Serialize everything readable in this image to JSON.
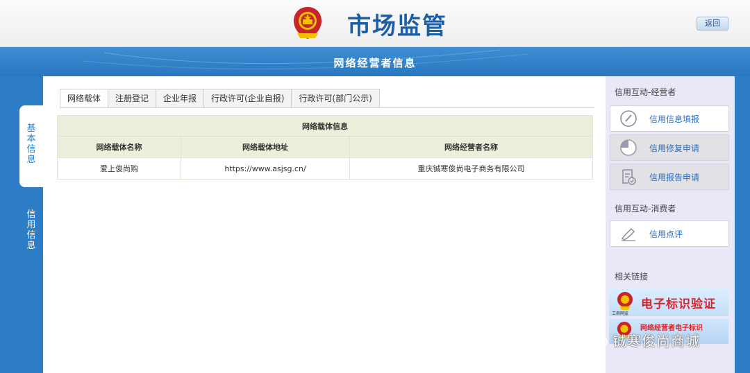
{
  "header": {
    "title": "市场监管",
    "back_label": "返回"
  },
  "section": {
    "title": "网络经营者信息"
  },
  "left_tabs": {
    "basic": "基本信息",
    "credit": "信用信息"
  },
  "tabs": [
    {
      "label": "网络载体"
    },
    {
      "label": "注册登记"
    },
    {
      "label": "企业年报"
    },
    {
      "label": "行政许可(企业自报)"
    },
    {
      "label": "行政许可(部门公示)"
    }
  ],
  "table": {
    "caption": "网络载体信息",
    "columns": [
      "网络载体名称",
      "网络载体地址",
      "网络经营者名称"
    ],
    "rows": [
      [
        "爱上俊尚购",
        "https://www.asjsg.cn/",
        "重庆铖寒俊尚电子商务有限公司"
      ]
    ]
  },
  "sidebar": {
    "operator_heading": "信用互动-经营者",
    "operator_items": [
      {
        "label": "信用信息填报",
        "icon": "pencil-circle-icon"
      },
      {
        "label": "信用修复申请",
        "icon": "pie-chart-icon"
      },
      {
        "label": "信用报告申请",
        "icon": "report-check-icon"
      }
    ],
    "consumer_heading": "信用互动-消费者",
    "consumer_items": [
      {
        "label": "信用点评",
        "icon": "comment-edit-icon"
      }
    ],
    "links_heading": "相关链接",
    "banner1": "电子标识验证",
    "banner1_sub": "工商网监",
    "banner2": "网络经营者电子标识"
  },
  "watermark": {
    "text": "铖寒俊尚商城"
  },
  "colors": {
    "brand_blue": "#2c7cc6",
    "title_blue": "#1a5ea8",
    "banner_red": "#d6262c"
  }
}
